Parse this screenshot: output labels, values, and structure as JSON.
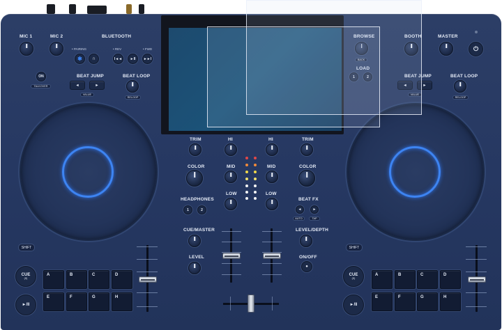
{
  "left_deck": {
    "mic1": "MIC 1",
    "mic2": "MIC 2",
    "bluetooth": "BLUETOOTH",
    "pairing": "• PAIRING",
    "rev": "• REV",
    "fwd": "• FWD",
    "on": "ON",
    "talkover": "TALKOVER",
    "beat_jump": "BEAT JUMP",
    "value": "VALUE",
    "beat_loop": "BEAT LOOP",
    "reloop": "RELOOP",
    "shift": "SHIFT",
    "cue": "CUE",
    "cue_sub": "(S)",
    "play": "►/II",
    "pads": [
      "A",
      "B",
      "C",
      "D",
      "E",
      "F",
      "G",
      "H"
    ]
  },
  "right_deck": {
    "browse": "BROWSE",
    "back": "BACK",
    "load": "LOAD",
    "load1": "1",
    "load2": "2",
    "booth": "BOOTH",
    "master": "MASTER",
    "beat_jump": "BEAT JUMP",
    "value": "VALUE",
    "beat_loop": "BEAT LOOP",
    "reloop": "RELOOP",
    "shift": "SHIFT",
    "cue": "CUE",
    "cue_sub": "(S)",
    "play": "►/II",
    "pads": [
      "A",
      "B",
      "C",
      "D",
      "E",
      "F",
      "G",
      "H"
    ]
  },
  "mixer": {
    "trim_l": "TRIM",
    "hi_l": "HI",
    "hi_r": "HI",
    "trim_r": "TRIM",
    "color_l": "COLOR",
    "mid_l": "MID",
    "mid_r": "MID",
    "color_r": "COLOR",
    "low_l": "LOW",
    "low_r": "LOW",
    "headphones": "HEADPHONES",
    "hp1": "1",
    "hp2": "2",
    "beat_fx": "BEAT FX",
    "auto": "AUTO",
    "tap": "TAP",
    "cue_master": "CUE/MASTER",
    "level": "LEVEL",
    "level_depth": "LEVEL/DEPTH",
    "on_off": "ON/OFF"
  },
  "colors": {
    "body": "#263862",
    "jog_ring": "#3d84f2",
    "screen": "#1b5278"
  }
}
